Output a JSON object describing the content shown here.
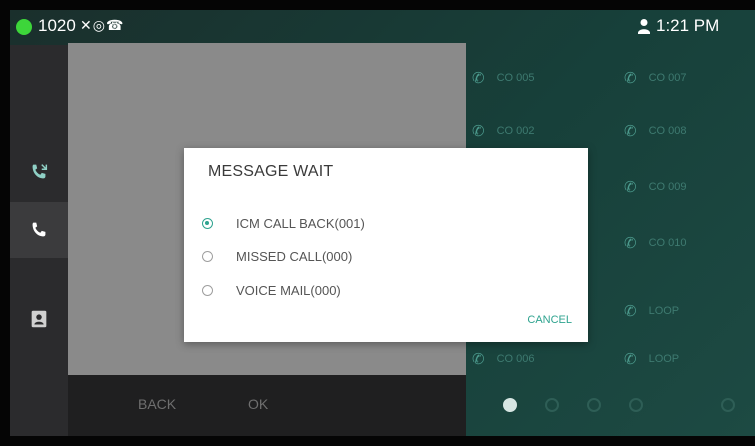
{
  "status": {
    "extension": "1020",
    "indicator_icons": "✕◎☎",
    "time": "1:21 PM"
  },
  "sidebar": {
    "items": [
      {
        "icon": "missed-call-icon"
      },
      {
        "icon": "phone-icon",
        "active": true
      },
      {
        "icon": "contacts-icon"
      }
    ]
  },
  "bottom_bar": {
    "back_label": "BACK",
    "ok_label": "OK"
  },
  "dsskeys": [
    {
      "label": "CO 005"
    },
    {
      "label": "CO 007"
    },
    {
      "label": "CO 002"
    },
    {
      "label": "CO 008"
    },
    {
      "label": "CO 009"
    },
    {
      "label": "CO 010"
    },
    {
      "label": "LOOP"
    },
    {
      "label": "CO 006"
    },
    {
      "label": "LOOP"
    }
  ],
  "dialog": {
    "title": "MESSAGE WAIT",
    "options": [
      {
        "label": "ICM CALL BACK(001)",
        "checked": true
      },
      {
        "label": "MISSED CALL(000)",
        "checked": false
      },
      {
        "label": "VOICE MAIL(000)",
        "checked": false
      }
    ],
    "cancel_label": "CANCEL"
  },
  "colors": {
    "accent": "#2fa38f",
    "status_online": "#3dd63a"
  }
}
